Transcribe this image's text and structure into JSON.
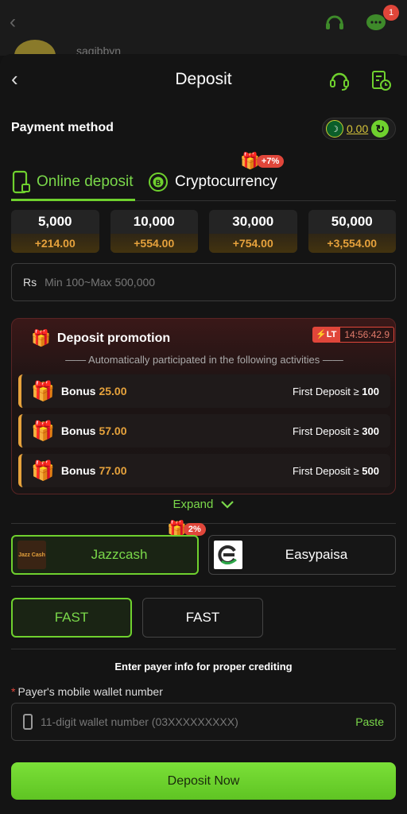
{
  "background_page": {
    "username": "sagibbyn",
    "notification_count": "1"
  },
  "header": {
    "title": "Deposit"
  },
  "payment_method": {
    "label": "Payment method",
    "balance": "0.00",
    "currency_flag": "PK"
  },
  "tabs": [
    {
      "label": "Online deposit",
      "active": true
    },
    {
      "label": "Cryptocurrency",
      "active": false,
      "promo": "+7%"
    }
  ],
  "amounts": [
    {
      "value": "5,000",
      "bonus": "+214.00"
    },
    {
      "value": "10,000",
      "bonus": "+554.00"
    },
    {
      "value": "30,000",
      "bonus": "+754.00"
    },
    {
      "value": "50,000",
      "bonus": "+3,554.00"
    }
  ],
  "amount_input": {
    "currency": "Rs",
    "placeholder": "Min 100~Max 500,000"
  },
  "promotion": {
    "title": "Deposit promotion",
    "lt_badge": "LT",
    "timer": "14:56:42.9",
    "subtitle": "—— Automatically participated in the following activities ——",
    "items": [
      {
        "label": "Bonus",
        "amount": "25.00",
        "condition": "First Deposit ≥",
        "threshold": "100"
      },
      {
        "label": "Bonus",
        "amount": "57.00",
        "condition": "First Deposit ≥",
        "threshold": "300"
      },
      {
        "label": "Bonus",
        "amount": "77.00",
        "condition": "First Deposit ≥",
        "threshold": "500"
      }
    ],
    "expand_label": "Expand"
  },
  "channels": [
    {
      "name": "Jazzcash",
      "selected": true,
      "promo": "2%",
      "logo_text": "Jazz Cash"
    },
    {
      "name": "Easypaisa",
      "selected": false
    }
  ],
  "speeds": [
    {
      "label": "FAST",
      "selected": true
    },
    {
      "label": "FAST",
      "selected": false
    }
  ],
  "payer": {
    "hint": "Enter payer info for proper crediting",
    "field_label": "Payer's mobile wallet number",
    "required_mark": "*",
    "placeholder": "11-digit wallet number (03XXXXXXXXX)",
    "paste_label": "Paste"
  },
  "submit": {
    "label": "Deposit Now"
  },
  "colors": {
    "accent": "#6fd12e",
    "bonus": "#e6a23c",
    "alert": "#e0463a",
    "background": "#141414"
  }
}
